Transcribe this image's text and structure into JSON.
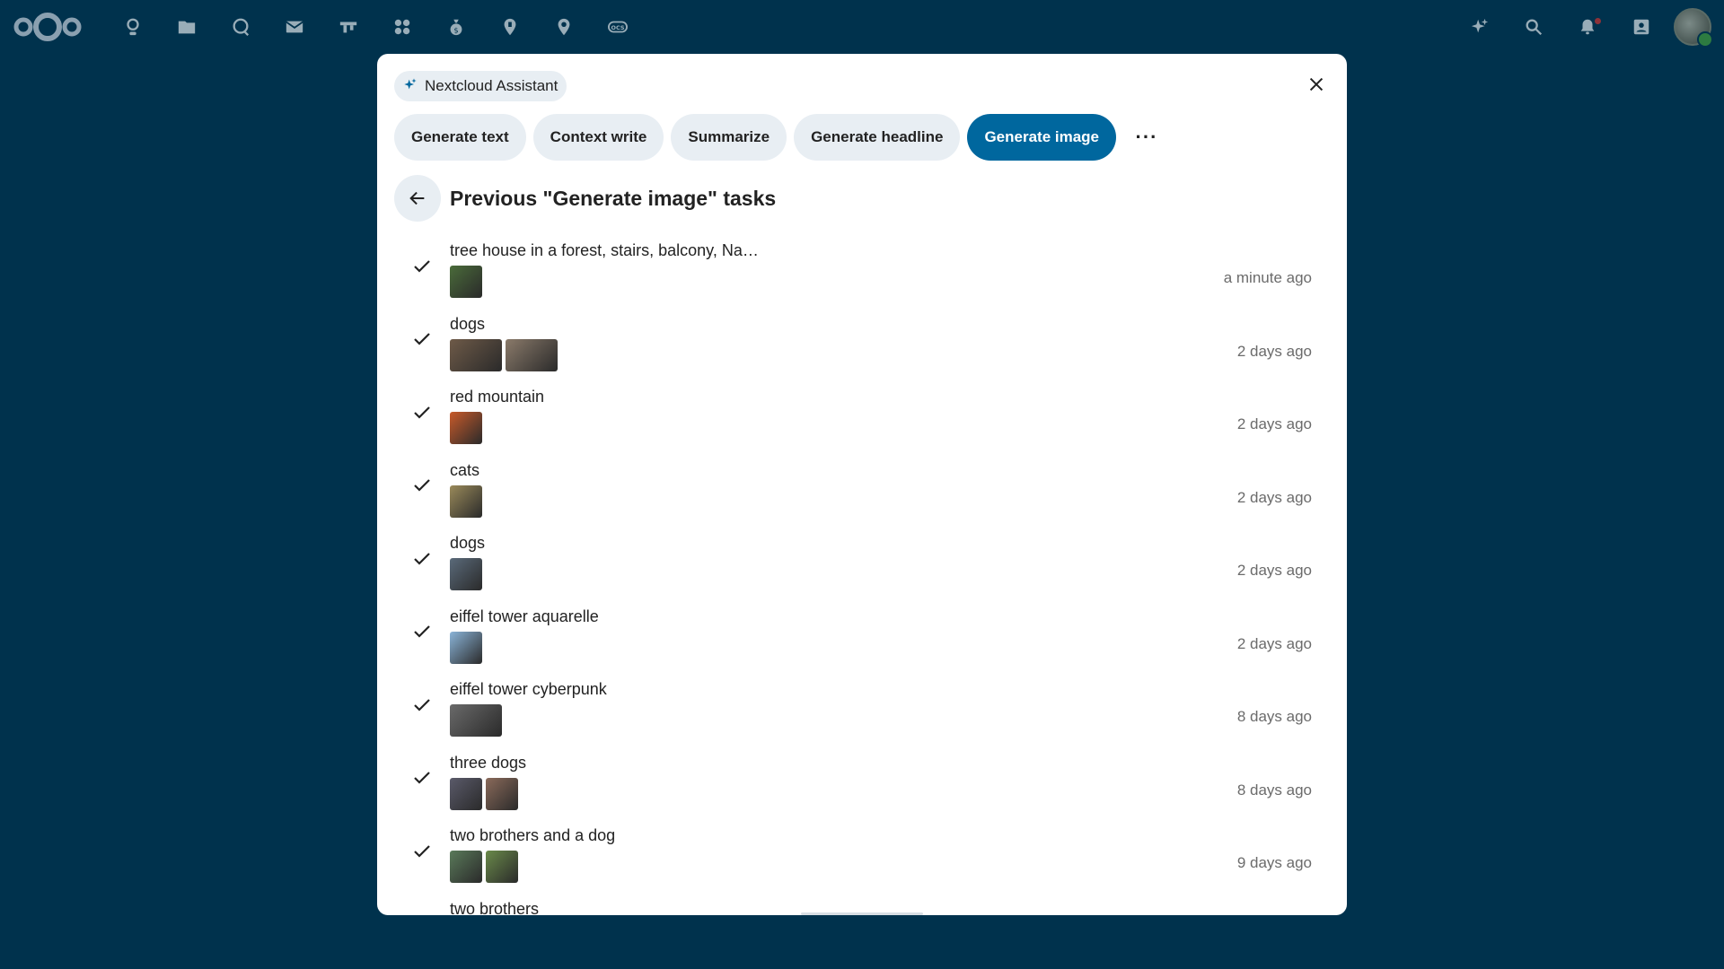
{
  "colors": {
    "background": "#00324d",
    "primary": "#00679e",
    "chip": "#e8eef3",
    "text": "#222222",
    "muted": "#6b6b6b"
  },
  "topbar": {
    "apps": [
      "dashboard-icon",
      "files-icon",
      "talk-icon",
      "mail-icon",
      "deck-icon",
      "apps-icon",
      "cospend-icon",
      "maps-icon",
      "phonetrack-icon",
      "ocs-icon"
    ],
    "right": [
      "assistant-icon",
      "search-icon",
      "notifications-icon",
      "contacts-icon"
    ]
  },
  "modal": {
    "badge": "Nextcloud Assistant",
    "tabs": [
      "Generate text",
      "Context write",
      "Summarize",
      "Generate headline",
      "Generate image"
    ],
    "active_tab": "Generate image",
    "more_label": "···",
    "section_title": "Previous \"Generate image\" tasks",
    "tasks": [
      {
        "name": "tree house in a forest, stairs, balcony, Na…",
        "time": "a minute ago",
        "status": "done",
        "thumbs": [
          "#4a6b3a"
        ]
      },
      {
        "name": "dogs",
        "time": "2 days ago",
        "status": "done",
        "thumbs": [
          "#6e5a48",
          "#8a7a6a"
        ],
        "wide": true
      },
      {
        "name": "red mountain",
        "time": "2 days ago",
        "status": "done",
        "thumbs": [
          "#c85a2a"
        ]
      },
      {
        "name": "cats",
        "time": "2 days ago",
        "status": "done",
        "thumbs": [
          "#9a8a5a"
        ]
      },
      {
        "name": "dogs",
        "time": "2 days ago",
        "status": "done",
        "thumbs": [
          "#5a6a7a"
        ]
      },
      {
        "name": "eiffel tower aquarelle",
        "time": "2 days ago",
        "status": "done",
        "thumbs": [
          "#8ab4d8"
        ]
      },
      {
        "name": "eiffel tower cyberpunk",
        "time": "8 days ago",
        "status": "done",
        "thumbs": [
          "#6a6a6a"
        ],
        "wide": true
      },
      {
        "name": "three dogs",
        "time": "8 days ago",
        "status": "done",
        "thumbs": [
          "#5a5a6a",
          "#8a6a5a"
        ]
      },
      {
        "name": "two brothers and a dog",
        "time": "9 days ago",
        "status": "done",
        "thumbs": [
          "#5a7a5a",
          "#6a8a4a"
        ]
      },
      {
        "name": "two brothers",
        "time": "",
        "status": "pending",
        "thumbs": []
      }
    ]
  }
}
